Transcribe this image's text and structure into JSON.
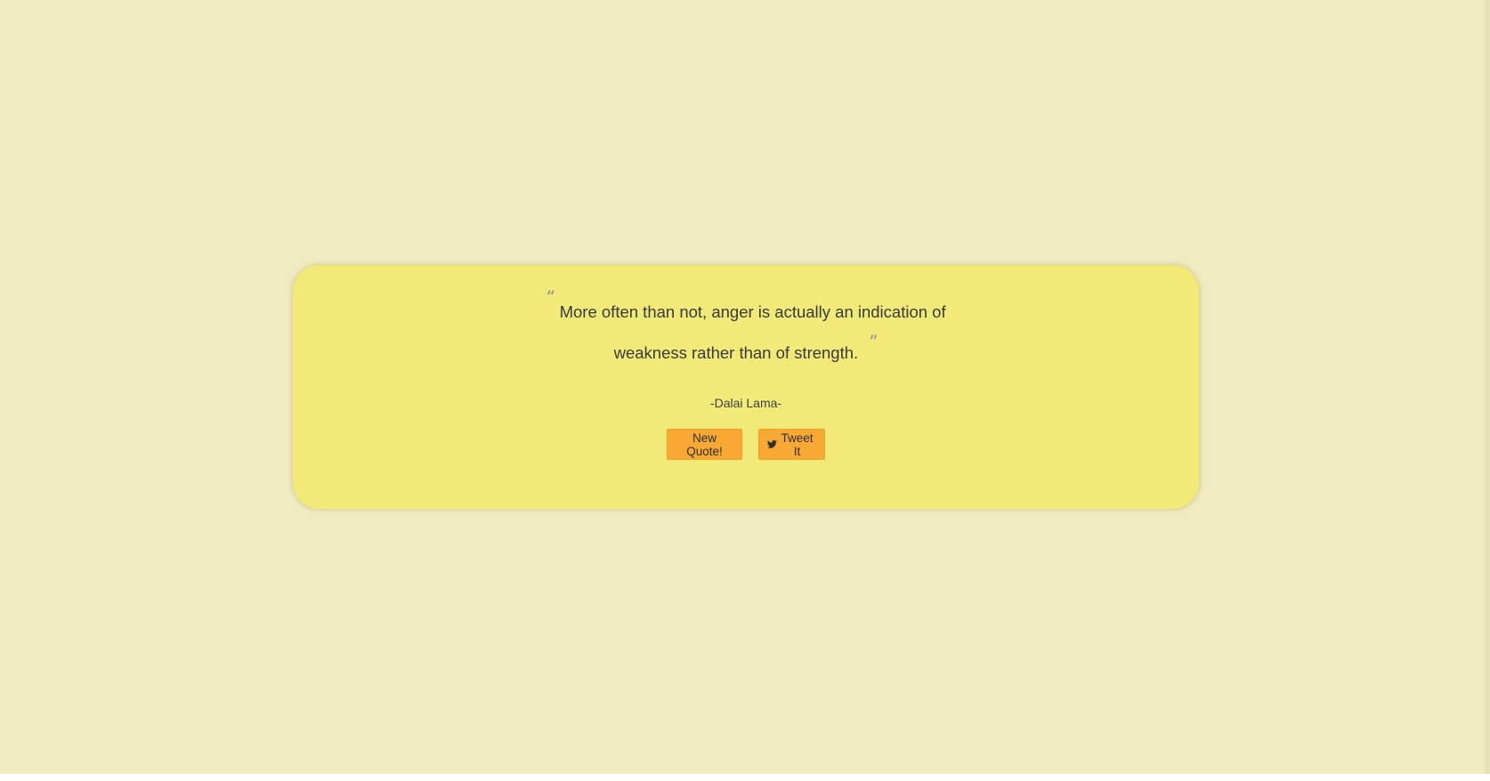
{
  "quote": {
    "open_mark": "“",
    "line1": "More often than not, anger is actually an indication of",
    "line2": "weakness rather than of strength.",
    "close_mark": "”"
  },
  "author": "-Dalai Lama-",
  "buttons": {
    "new_quote_label": "New Quote!",
    "tweet_label": "Tweet It",
    "tweet_icon": "twitter-icon"
  },
  "colors": {
    "page_background": "#f1ebc1",
    "card_background": "#f2ea78",
    "button_background": "#f7a933"
  }
}
